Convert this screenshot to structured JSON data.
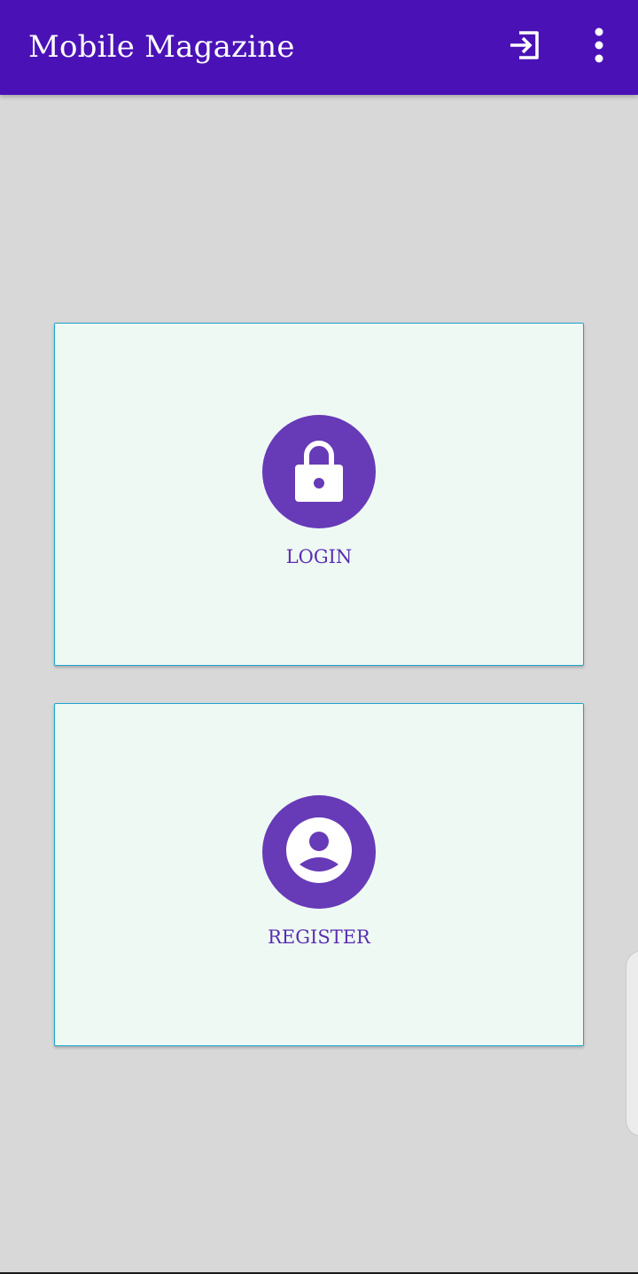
{
  "app_bar": {
    "title": "Mobile Magazine",
    "background_color": "#4a12b6",
    "actions": [
      {
        "icon": "login-arrow-icon"
      },
      {
        "icon": "more-vertical-icon"
      }
    ]
  },
  "cards": {
    "login": {
      "label": "LOGIN",
      "icon": "lock-icon"
    },
    "register": {
      "label": "REGISTER",
      "icon": "account-circle-icon"
    }
  },
  "colors": {
    "screen_background": "#d8d8d8",
    "card_background": "#eef9f4",
    "card_border": "#1fa5cf",
    "icon_circle": "#673ab7",
    "label_text": "#5a2eb0"
  }
}
